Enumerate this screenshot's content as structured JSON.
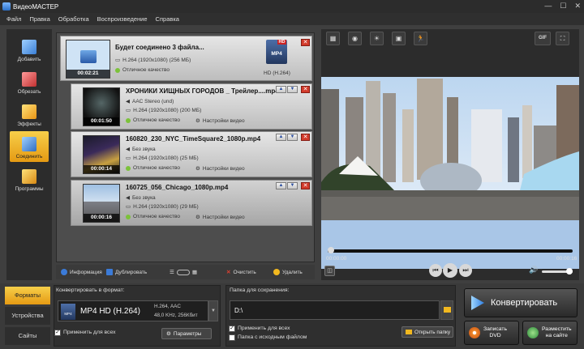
{
  "window": {
    "title": "ВидеоМАСТЕР"
  },
  "menu": [
    "Файл",
    "Правка",
    "Обработка",
    "Воспроизведение",
    "Справка"
  ],
  "sidebar": [
    {
      "label": "Добавить",
      "icon": "add-file-icon",
      "active": false
    },
    {
      "label": "Обрезать",
      "icon": "cut-icon",
      "active": false
    },
    {
      "label": "Эффекты",
      "icon": "effects-icon",
      "active": false
    },
    {
      "label": "Соединить",
      "icon": "join-icon",
      "active": true
    },
    {
      "label": "Программы",
      "icon": "programs-icon",
      "active": false
    }
  ],
  "merged": {
    "title": "Будет соединено 3 файла...",
    "codec": "H.264 (1920x1080) (256 МБ)",
    "quality": "Отличное качество",
    "time": "00:02:21",
    "badge": "MP4",
    "badge_hd": "HD",
    "format": "HD (H.264)"
  },
  "clips": [
    {
      "title": "ХРОНИКИ ХИЩНЫХ ГОРОДОВ _ Трейлер....mp4",
      "audio": "AAC Stereo (und)",
      "codec": "H.264 (1920x1080) (200 МБ)",
      "quality": "Отличное качество",
      "settings": "Настройки видео",
      "time": "00:01:50"
    },
    {
      "title": "160820_230_NYC_TimeSquare2_1080p.mp4",
      "audio": "Без звука",
      "codec": "H.264 (1920x1080) (25 МБ)",
      "quality": "Отличное качество",
      "settings": "Настройки видео",
      "time": "00:00:14"
    },
    {
      "title": "160725_056_Chicago_1080p.mp4",
      "audio": "Без звука",
      "codec": "H.264 (1920x1080) (29 МБ)",
      "quality": "Отличное качество",
      "settings": "Настройки видео",
      "time": "00:00:16"
    }
  ],
  "list_toolbar": {
    "info": "Информация",
    "duplicate": "Дублировать",
    "clear": "Очистить",
    "delete": "Удалить"
  },
  "preview": {
    "time_start": "00:00:00",
    "time_end": "00:00:16",
    "gif": "GIF",
    "progress": 0
  },
  "bottom_tabs": [
    {
      "label": "Форматы",
      "active": true
    },
    {
      "label": "Устройства",
      "active": false
    },
    {
      "label": "Сайты",
      "active": false
    }
  ],
  "format": {
    "header": "Конвертировать в формат:",
    "name": "MP4 HD (H.264)",
    "codec": "H.264, AAC",
    "audio": "48,0 KHz, 256Кбит",
    "apply_all": "Применить для всех",
    "params": "Параметры",
    "icon_label": "MP4"
  },
  "save": {
    "header": "Папка для сохранения:",
    "path": "D:\\",
    "apply_all": "Применить для всех",
    "source_folder": "Папка с исходным файлом",
    "open_folder": "Открыть папку"
  },
  "actions": {
    "convert": "Конвертировать",
    "dvd": "Записать\nDVD",
    "site": "Разместить\nна сайте"
  }
}
